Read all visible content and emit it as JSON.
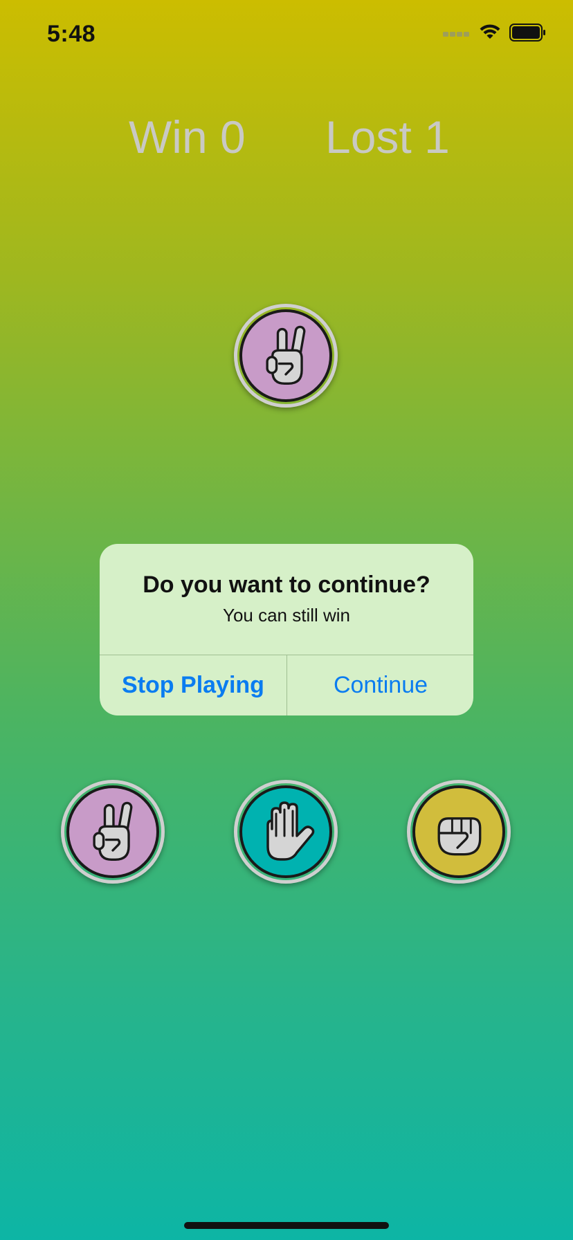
{
  "status_bar": {
    "time": "5:48",
    "icons": [
      "cellular-signal-icon",
      "wifi-icon",
      "battery-icon"
    ]
  },
  "score": {
    "win_label": "Win 0",
    "lost_label": "Lost 1"
  },
  "opponent_choice": {
    "icon": "scissors-hand-icon",
    "color": "#c89bc8"
  },
  "alert": {
    "title": "Do you want to continue?",
    "message": "You can still win",
    "stop_label": "Stop Playing",
    "continue_label": "Continue"
  },
  "choices": [
    {
      "icon": "scissors-hand-icon",
      "color": "#c89bc8"
    },
    {
      "icon": "paper-hand-icon",
      "color": "#00b2b0"
    },
    {
      "icon": "rock-hand-icon",
      "color": "#d1bd3c"
    }
  ],
  "colors": {
    "accent": "#0a7cf0",
    "score_text": "#c9c9c4",
    "alert_background": "#d6f0c8"
  }
}
